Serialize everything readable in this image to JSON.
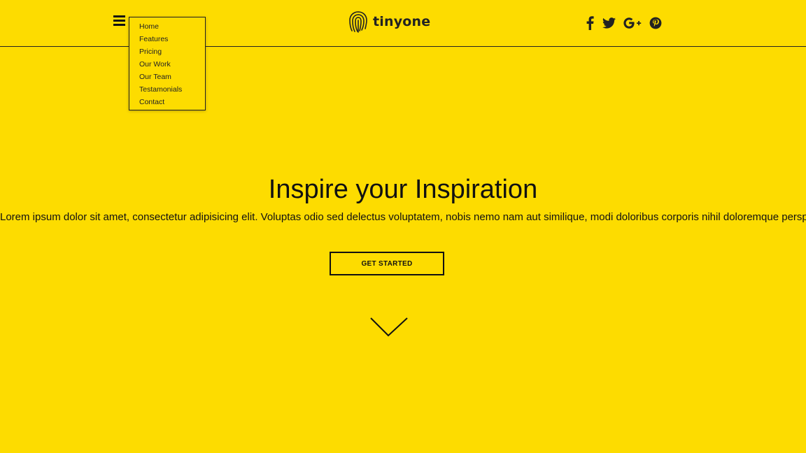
{
  "header": {
    "brand": "tinyone",
    "brand_icon": "fingerprint-icon",
    "menu_icon": "hamburger-menu-icon",
    "social": [
      "facebook-icon",
      "twitter-icon",
      "google-plus-icon",
      "pinterest-icon"
    ]
  },
  "menu": {
    "items": [
      {
        "label": "Home"
      },
      {
        "label": "Features"
      },
      {
        "label": "Pricing"
      },
      {
        "label": "Our Work"
      },
      {
        "label": "Our Team"
      },
      {
        "label": "Testamonials"
      },
      {
        "label": "Contact"
      }
    ]
  },
  "hero": {
    "title": "Inspire your Inspiration",
    "text": "Lorem ipsum dolor sit amet, consectetur adipisicing elit. Voluptas odio sed delectus voluptatem, nobis nemo nam aut similique, modi doloribus corporis nihil doloremque perspiciatis ipsum.",
    "cta_label": "GET STARTED",
    "scroll_icon": "chevron-down-icon"
  },
  "colors": {
    "background": "#fddc00",
    "text": "#111111"
  }
}
